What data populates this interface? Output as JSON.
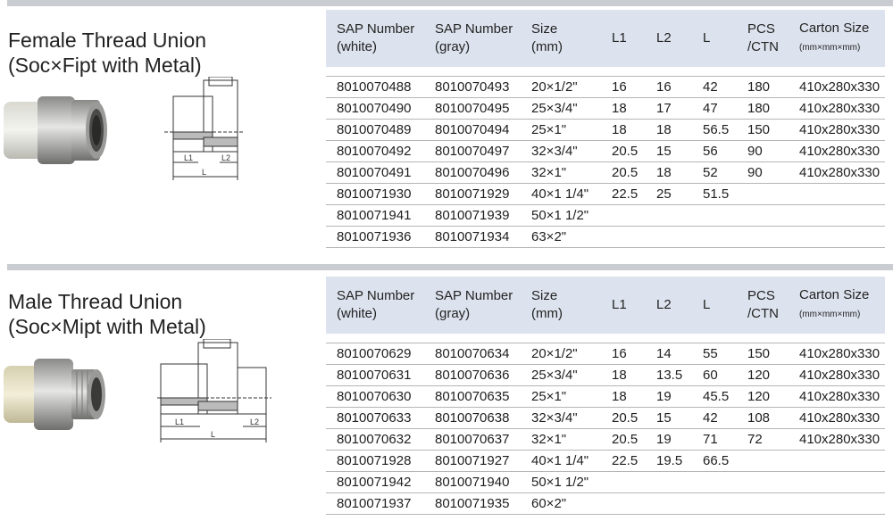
{
  "columns": {
    "sap_white": [
      "SAP Number",
      "(white)"
    ],
    "sap_gray": [
      "SAP Number",
      "(gray)"
    ],
    "size": [
      "Size",
      "(mm)"
    ],
    "l1": "L1",
    "l2": "L2",
    "l": "L",
    "pcs": [
      "PCS",
      "/CTN"
    ],
    "carton": [
      "Carton Size",
      "(mm×mm×mm)"
    ]
  },
  "sections": [
    {
      "title_line1": "Female Thread Union",
      "title_line2": "(Soc×Fipt with Metal)",
      "drawing_labels": {
        "l1": "L1",
        "l2": "L2",
        "l": "L"
      },
      "rows": [
        [
          "8010070488",
          "8010070493",
          "20×1/2\"",
          "16",
          "16",
          "42",
          "180",
          "410x280x330"
        ],
        [
          "8010070490",
          "8010070495",
          "25×3/4\"",
          "18",
          "17",
          "47",
          "180",
          "410x280x330"
        ],
        [
          "8010070489",
          "8010070494",
          "25×1\"",
          "18",
          "18",
          "56.5",
          "150",
          "410x280x330"
        ],
        [
          "8010070492",
          "8010070497",
          "32×3/4\"",
          "20.5",
          "15",
          "56",
          "90",
          "410x280x330"
        ],
        [
          "8010070491",
          "8010070496",
          "32×1\"",
          "20.5",
          "18",
          "52",
          "90",
          "410x280x330"
        ],
        [
          "8010071930",
          "8010071929",
          "40×1 1/4\"",
          "22.5",
          "25",
          "51.5",
          "",
          ""
        ],
        [
          "8010071941",
          "8010071939",
          "50×1 1/2\"",
          "",
          "",
          "",
          "",
          ""
        ],
        [
          "8010071936",
          "8010071934",
          "63×2\"",
          "",
          "",
          "",
          "",
          ""
        ]
      ]
    },
    {
      "title_line1": "Male Thread Union",
      "title_line2": "(Soc×Mipt with Metal)",
      "drawing_labels": {
        "l1": "L1",
        "l2": "L2",
        "l": "L"
      },
      "rows": [
        [
          "8010070629",
          "8010070634",
          "20×1/2\"",
          "16",
          "14",
          "55",
          "150",
          "410x280x330"
        ],
        [
          "8010070631",
          "8010070636",
          "25×3/4\"",
          "18",
          "13.5",
          "60",
          "120",
          "410x280x330"
        ],
        [
          "8010070630",
          "8010070635",
          "25×1\"",
          "18",
          "19",
          "45.5",
          "120",
          "410x280x330"
        ],
        [
          "8010070633",
          "8010070638",
          "32×3/4\"",
          "20.5",
          "15",
          "42",
          "108",
          "410x280x330"
        ],
        [
          "8010070632",
          "8010070637",
          "32×1\"",
          "20.5",
          "19",
          "71",
          "72",
          "410x280x330"
        ],
        [
          "8010071928",
          "8010071927",
          "40×1 1/4\"",
          "22.5",
          "19.5",
          "66.5",
          "",
          ""
        ],
        [
          "8010071942",
          "8010071940",
          "50×1 1/2\"",
          "",
          "",
          "",
          "",
          ""
        ],
        [
          "8010071937",
          "8010071935",
          "60×2\"",
          "",
          "",
          "",
          "",
          ""
        ]
      ]
    }
  ]
}
